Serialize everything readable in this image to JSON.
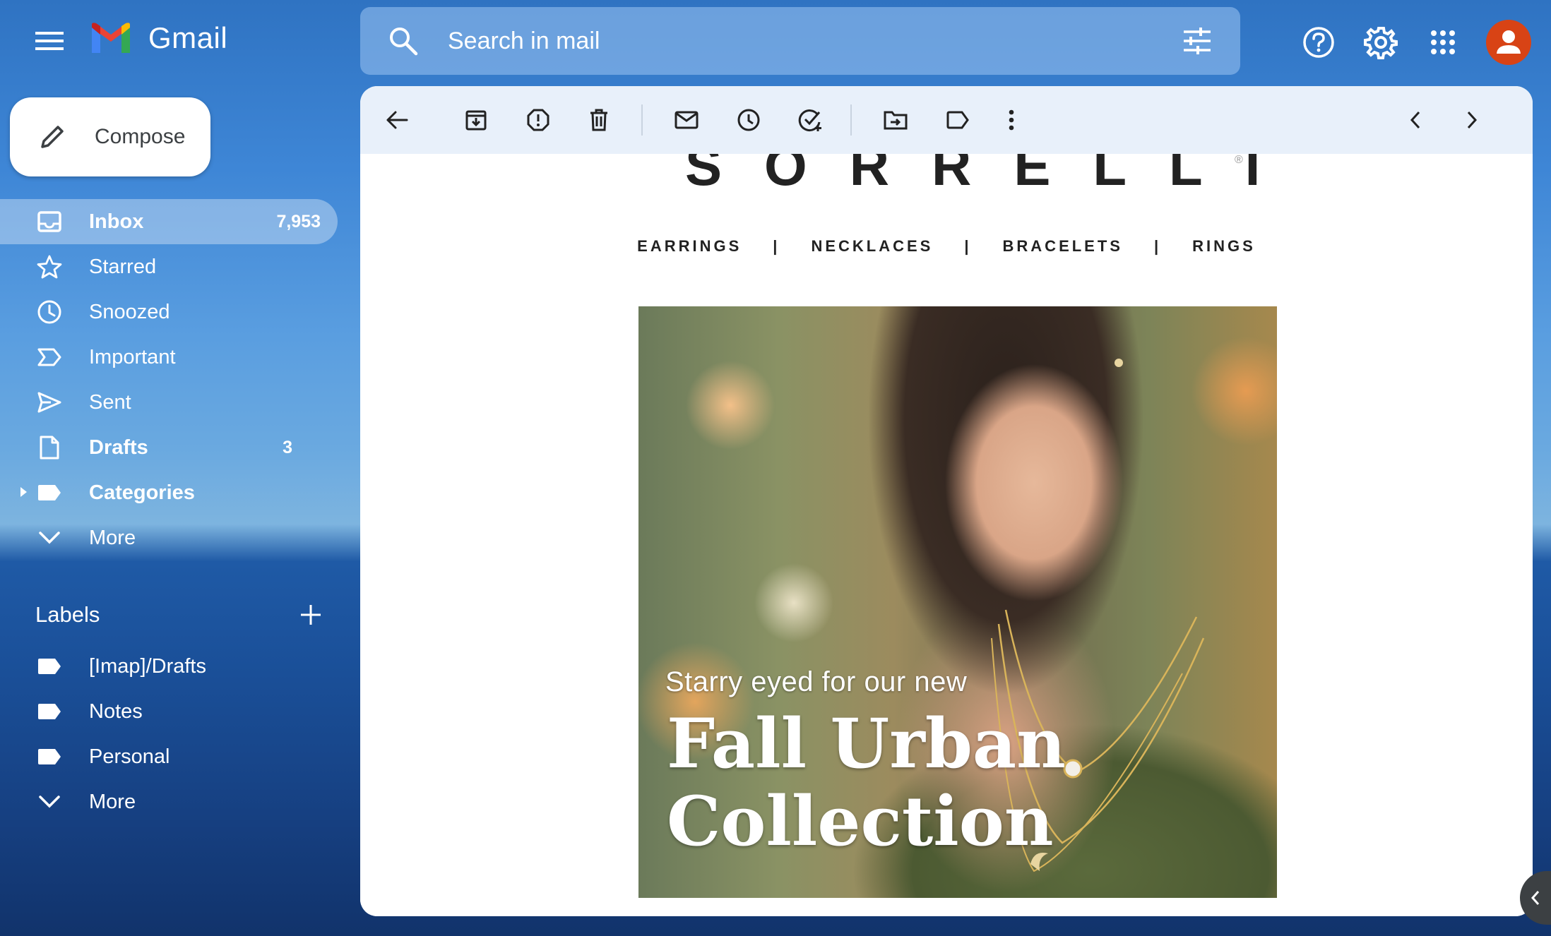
{
  "app": {
    "name": "Gmail"
  },
  "search": {
    "placeholder": "Search in mail"
  },
  "compose": {
    "label": "Compose"
  },
  "nav": {
    "items": [
      {
        "label": "Inbox",
        "count": "7,953"
      },
      {
        "label": "Starred",
        "count": ""
      },
      {
        "label": "Snoozed",
        "count": ""
      },
      {
        "label": "Important",
        "count": ""
      },
      {
        "label": "Sent",
        "count": ""
      },
      {
        "label": "Drafts",
        "count": "3"
      },
      {
        "label": "Categories",
        "count": ""
      },
      {
        "label": "More",
        "count": ""
      }
    ]
  },
  "labels": {
    "heading": "Labels",
    "items": [
      {
        "label": "[Imap]/Drafts"
      },
      {
        "label": "Notes"
      },
      {
        "label": "Personal"
      },
      {
        "label": "More"
      }
    ]
  },
  "email": {
    "brand": "SORRELLI",
    "brand_mark": "®",
    "categories": [
      "EARRINGS",
      "|",
      "NECKLACES",
      "|",
      "BRACELETS",
      "|",
      "RINGS"
    ],
    "hero_subline": "Starry eyed for our new",
    "hero_headline_1": "Fall Urban",
    "hero_headline_2": "Collection"
  },
  "icons": {
    "menu": "menu-icon",
    "search": "search-icon",
    "tune": "tune-icon",
    "help": "help-icon",
    "settings": "gear-icon",
    "apps": "apps-grid-icon",
    "account": "account-icon"
  },
  "colors": {
    "avatar": "#d84315",
    "toolbar_bg": "#e8f0fa",
    "active_nav": "rgba(255,255,255,0.35)"
  }
}
